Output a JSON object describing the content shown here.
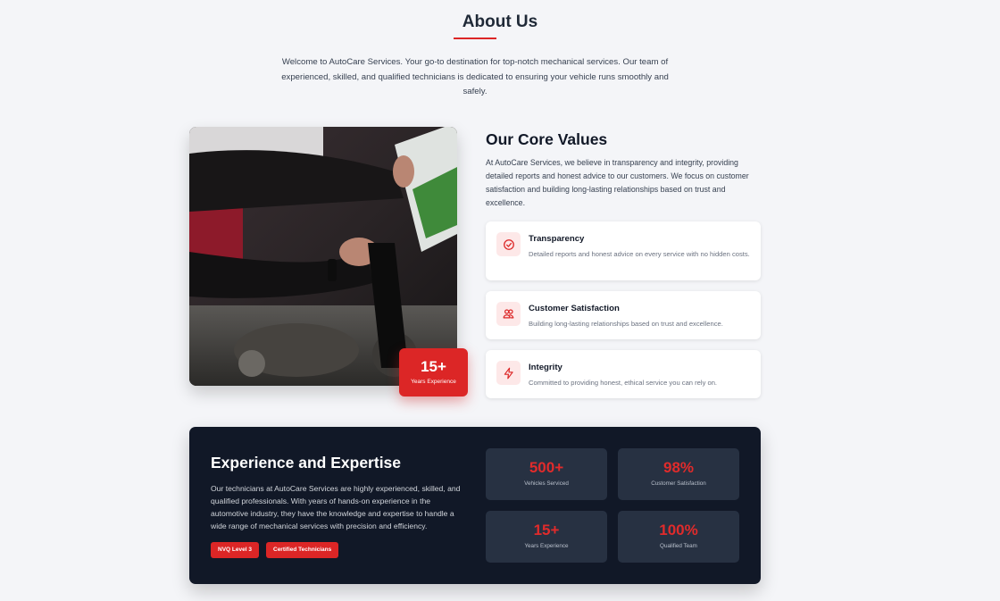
{
  "about": {
    "title": "About Us",
    "intro": "Welcome to AutoCare Services. Your go-to destination for top-notch mechanical services. Our team of experienced, skilled, and qualified technicians is dedicated to ensuring your vehicle runs smoothly and safely."
  },
  "image_badge": {
    "value": "15+",
    "label": "Years Experience"
  },
  "core_values": {
    "title": "Our Core Values",
    "description": "At AutoCare Services, we believe in transparency and integrity, providing detailed reports and honest advice to our customers. We focus on customer satisfaction and building long-lasting relationships based on trust and excellence.",
    "items": [
      {
        "icon": "check-circle-icon",
        "title": "Transparency",
        "description": "Detailed reports and honest advice on every service with no hidden costs."
      },
      {
        "icon": "users-icon",
        "title": "Customer Satisfaction",
        "description": "Building long-lasting relationships based on trust and excellence."
      },
      {
        "icon": "lightning-icon",
        "title": "Integrity",
        "description": "Committed to providing honest, ethical service you can rely on."
      }
    ]
  },
  "experience": {
    "title": "Experience and Expertise",
    "description": "Our technicians at AutoCare Services are highly experienced, skilled, and qualified professionals. With years of hands-on experience in the automotive industry, they have the knowledge and expertise to handle a wide range of mechanical services with precision and efficiency.",
    "tags": [
      "NVQ Level 3",
      "Certified Technicians"
    ],
    "stats": [
      {
        "value": "500+",
        "label": "Vehicles Serviced"
      },
      {
        "value": "98%",
        "label": "Customer Satisfaction"
      },
      {
        "value": "15+",
        "label": "Years Experience"
      },
      {
        "value": "100%",
        "label": "Qualified Team"
      }
    ]
  },
  "colors": {
    "accent": "#dc2626",
    "dark_panel": "#111827",
    "stat_box": "#273142",
    "page_bg": "#f4f5f8",
    "icon_bg": "#fde8e8"
  }
}
